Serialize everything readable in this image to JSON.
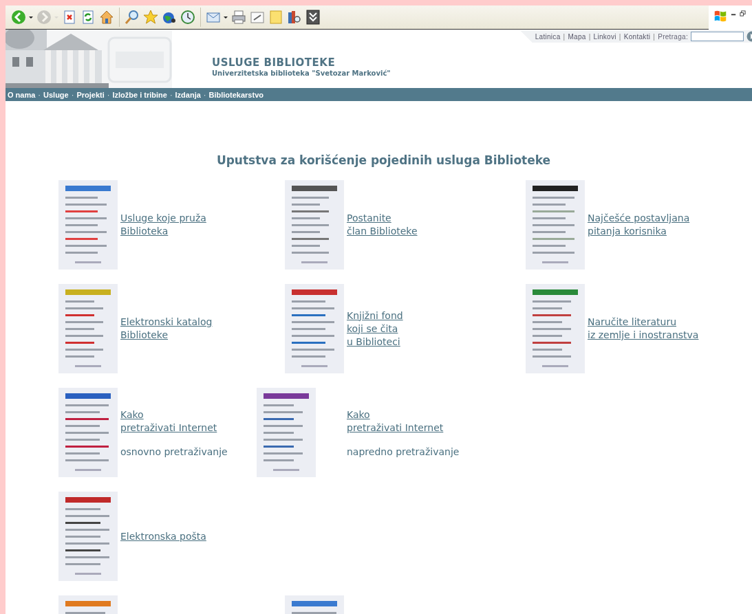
{
  "toolbar": {
    "buttons": [
      {
        "kind": "back",
        "disabled": false,
        "menu": true
      },
      {
        "kind": "forward",
        "disabled": true,
        "menu": true
      },
      {
        "kind": "stop",
        "disabled": false,
        "menu": false
      },
      {
        "kind": "refresh",
        "disabled": false,
        "menu": false
      },
      {
        "kind": "home",
        "disabled": false,
        "menu": false
      },
      {
        "kind": "search",
        "disabled": false,
        "menu": false
      },
      {
        "kind": "favorites",
        "disabled": false,
        "menu": false
      },
      {
        "kind": "media",
        "disabled": false,
        "menu": false
      },
      {
        "kind": "history",
        "disabled": false,
        "menu": false
      },
      {
        "kind": "mail",
        "disabled": false,
        "menu": true
      },
      {
        "kind": "print",
        "disabled": false,
        "menu": false
      },
      {
        "kind": "edit",
        "disabled": false,
        "menu": false
      },
      {
        "kind": "note",
        "disabled": false,
        "menu": false
      },
      {
        "kind": "research",
        "disabled": false,
        "menu": false
      },
      {
        "kind": "more",
        "disabled": false,
        "menu": false
      }
    ]
  },
  "top_links": [
    {
      "kind": "link",
      "text": "Latinica"
    },
    {
      "kind": "separator",
      "text": "|"
    },
    {
      "kind": "link",
      "text": "Mapa"
    },
    {
      "kind": "separator",
      "text": "|"
    },
    {
      "kind": "link",
      "text": "Linkovi"
    },
    {
      "kind": "separator",
      "text": "|"
    },
    {
      "kind": "link",
      "text": "Kontakti"
    },
    {
      "kind": "separator",
      "text": "|"
    },
    {
      "kind": "label",
      "text": "Pretraga:"
    }
  ],
  "header": {
    "title": "USLUGE BIBLIOTEKE",
    "subtitle": "Univerzitetska biblioteka \"Svetozar Marković\""
  },
  "nav": [
    {
      "kind": "link",
      "text": "O nama"
    },
    {
      "kind": "separator",
      "text": "·"
    },
    {
      "kind": "link",
      "text": "Usluge"
    },
    {
      "kind": "separator",
      "text": "·"
    },
    {
      "kind": "link",
      "text": "Projekti"
    },
    {
      "kind": "separator",
      "text": "·"
    },
    {
      "kind": "link",
      "text": "Izložbe i tribine"
    },
    {
      "kind": "separator",
      "text": "·"
    },
    {
      "kind": "link",
      "text": "Izdanja"
    },
    {
      "kind": "separator",
      "text": "·"
    },
    {
      "kind": "link",
      "text": "Bibliotekarstvo"
    }
  ],
  "heading": "Uputstva za korišćenje pojedinih usluga Biblioteke",
  "rows": [
    {
      "kind": "grid",
      "items": [
        {
          "kind": "entry",
          "link": [
            "Usluge koje pruža",
            "Biblioteka"
          ]
        },
        {
          "kind": "entry",
          "link": [
            "Postanite",
            "član Biblioteke"
          ]
        },
        {
          "kind": "entry",
          "link": [
            "Najčešće postavljana",
            "pitanja korisnika"
          ]
        }
      ]
    },
    {
      "kind": "grid",
      "items": [
        {
          "kind": "entry",
          "link": [
            "Elektronski katalog",
            "Biblioteke"
          ]
        },
        {
          "kind": "entry",
          "link": [
            "Knjižni fond",
            "koji se čita",
            "u Biblioteci"
          ]
        },
        {
          "kind": "entry",
          "link": [
            "Naručite literaturu",
            "iz zemlje i inostranstva"
          ]
        }
      ]
    },
    {
      "kind": "wide",
      "items": [
        {
          "kind": "entry",
          "link": [
            "Kako",
            "pretraživati Internet"
          ],
          "note": "osnovno pretraživanje"
        },
        {
          "kind": "entry",
          "link": [
            "Kako",
            "pretraživati Internet"
          ],
          "note": "napredno pretraživanje"
        }
      ]
    },
    {
      "kind": "grid",
      "items": [
        {
          "kind": "entry",
          "link": [
            "Elektronska pošta"
          ]
        }
      ]
    },
    {
      "kind": "grid"
    }
  ]
}
